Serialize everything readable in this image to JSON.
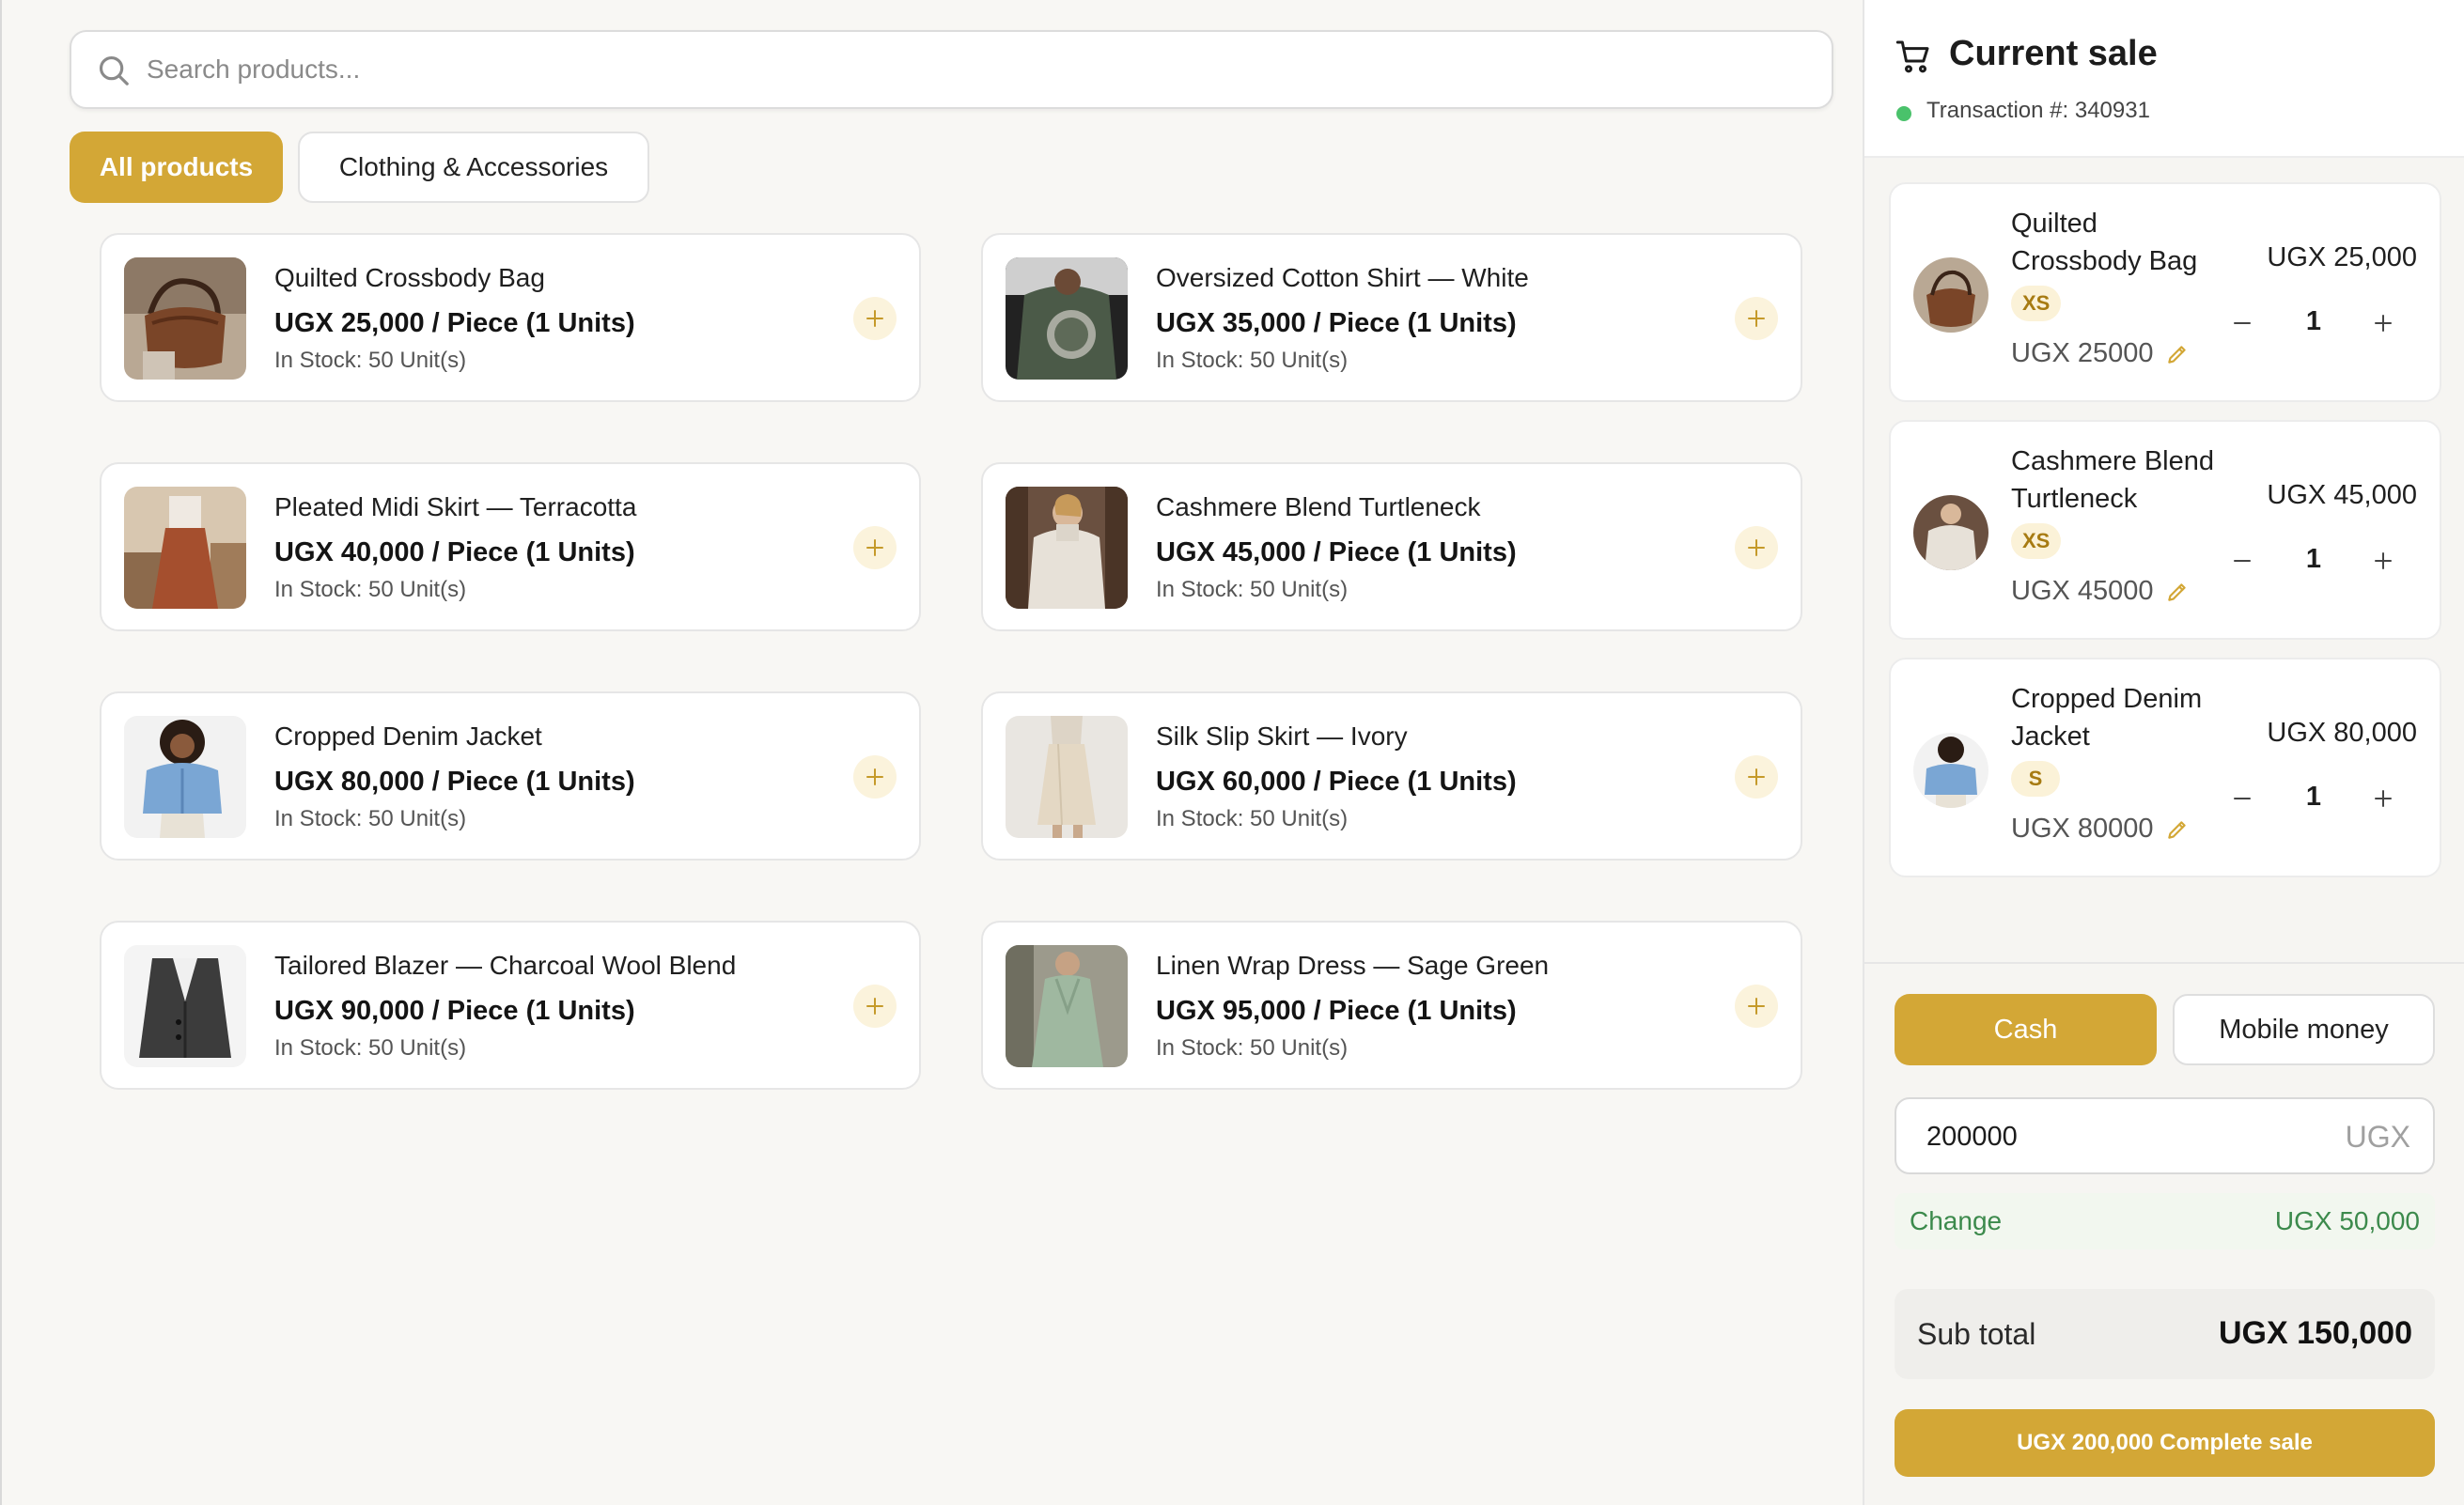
{
  "search": {
    "placeholder": "Search products..."
  },
  "categories": [
    {
      "label": "All products",
      "active": true
    },
    {
      "label": "Clothing & Accessories",
      "active": false
    }
  ],
  "products": [
    {
      "name": "Quilted Crossbody Bag",
      "price": "UGX 25,000 / Piece (1 Units)",
      "stock": "In Stock: 50 Unit(s)"
    },
    {
      "name": "Oversized Cotton Shirt — White",
      "price": "UGX 35,000 / Piece (1 Units)",
      "stock": "In Stock: 50 Unit(s)"
    },
    {
      "name": "Pleated Midi Skirt — Terracotta",
      "price": "UGX 40,000 / Piece (1 Units)",
      "stock": "In Stock: 50 Unit(s)"
    },
    {
      "name": "Cashmere Blend Turtleneck",
      "price": "UGX 45,000 / Piece (1 Units)",
      "stock": "In Stock: 50 Unit(s)"
    },
    {
      "name": "Cropped Denim Jacket",
      "price": "UGX 80,000 / Piece (1 Units)",
      "stock": "In Stock: 50 Unit(s)"
    },
    {
      "name": "Silk Slip Skirt — Ivory",
      "price": "UGX 60,000 / Piece (1 Units)",
      "stock": "In Stock: 50 Unit(s)"
    },
    {
      "name": "Tailored Blazer — Charcoal Wool Blend",
      "price": "UGX 90,000 / Piece (1 Units)",
      "stock": "In Stock: 50 Unit(s)"
    },
    {
      "name": "Linen Wrap Dress — Sage Green",
      "price": "UGX 95,000 / Piece (1 Units)",
      "stock": "In Stock: 50 Unit(s)"
    }
  ],
  "sale": {
    "title": "Current sale",
    "transaction": "Transaction #: 340931",
    "items": [
      {
        "name": "Quilted Crossbody Bag",
        "size": "XS",
        "subtotal": "UGX 25000",
        "price": "UGX 25,000",
        "qty": "1"
      },
      {
        "name": "Cashmere Blend Turtleneck",
        "size": "XS",
        "subtotal": "UGX 45000",
        "price": "UGX 45,000",
        "qty": "1"
      },
      {
        "name": "Cropped Denim Jacket",
        "size": "S",
        "subtotal": "UGX 80000",
        "price": "UGX 80,000",
        "qty": "1"
      }
    ]
  },
  "payment": {
    "methods": [
      "Cash",
      "Mobile money"
    ],
    "selected": "Cash",
    "amount": "200000",
    "currency": "UGX",
    "change_label": "Change",
    "change_value": "UGX 50,000",
    "subtotal_label": "Sub total",
    "subtotal_value": "UGX 150,000",
    "complete_label": "UGX 200,000 Complete sale"
  },
  "colors": {
    "accent": "#d3a736",
    "success": "#3c8a4c",
    "status_dot": "#4ac26b"
  }
}
